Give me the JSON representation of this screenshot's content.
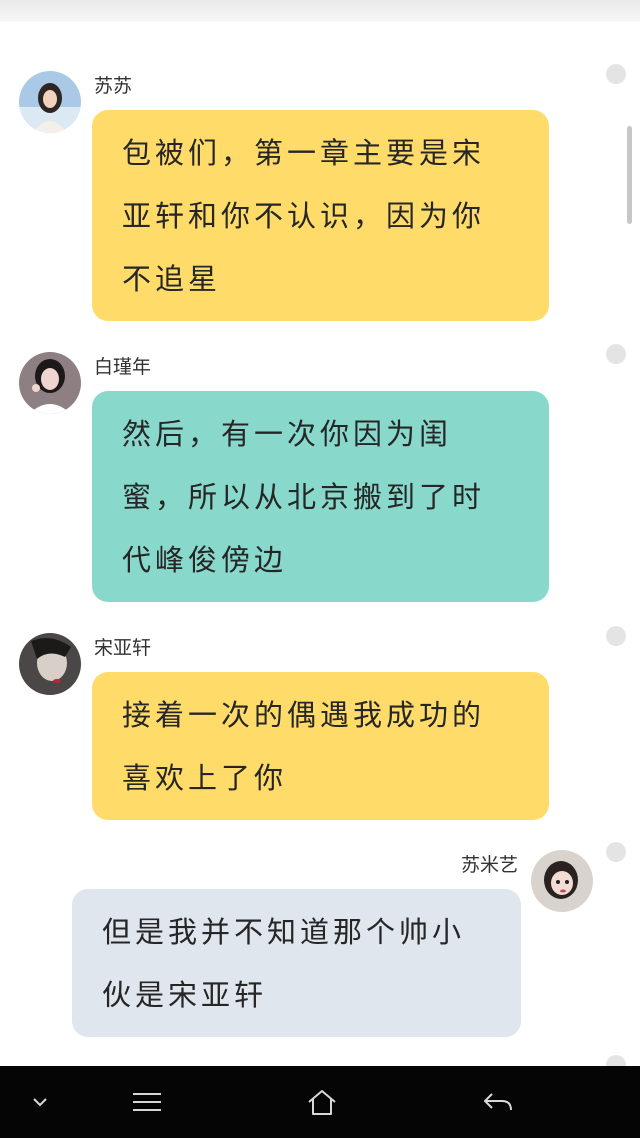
{
  "messages": [
    {
      "sender": "苏苏",
      "side": "left",
      "lines": [
        "包被们，第一章主要是宋",
        "亚轩和你不认识，因为你",
        "不追星"
      ],
      "bubble_color": "#ffdc6a"
    },
    {
      "sender": "白瑾年",
      "side": "left",
      "lines": [
        "然后，有一次你因为闺",
        "蜜，所以从北京搬到了时",
        "代峰俊傍边"
      ],
      "bubble_color": "#88d9cc"
    },
    {
      "sender": "宋亚轩",
      "side": "left",
      "lines": [
        "接着一次的偶遇我成功的",
        "喜欢上了你"
      ],
      "bubble_color": "#ffdc6a"
    },
    {
      "sender": "苏米艺",
      "side": "right",
      "lines": [
        "但是我并不知道那个帅小",
        "伙是宋亚轩"
      ],
      "bubble_color": "#dfe6ee"
    }
  ],
  "navbar": {
    "icons": [
      "chevron-down-icon",
      "menu-icon",
      "home-icon",
      "back-icon"
    ]
  }
}
